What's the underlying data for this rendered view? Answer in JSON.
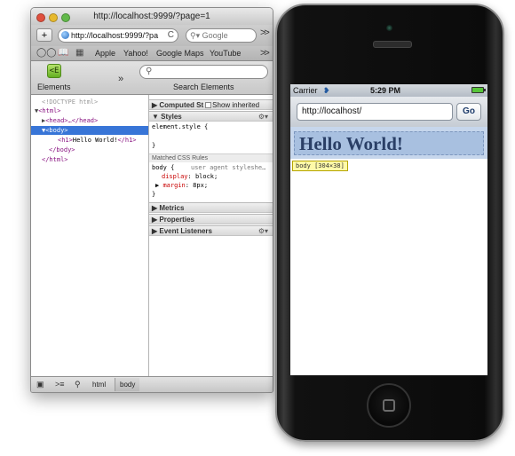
{
  "safari": {
    "title": "http://localhost:9999/?page=1",
    "url": "http://localhost:9999/?pa",
    "reload_glyph": "C",
    "search_placeholder": "Google",
    "bookmarks": [
      "Apple",
      "Yahoo!",
      "Google Maps",
      "YouTube"
    ],
    "chevron": ">>"
  },
  "inspector": {
    "elements_label": "Elements",
    "elements_glyph": "<E",
    "chevron": "»",
    "search_label": "Search Elements",
    "dom": {
      "doctype": "<!DOCTYPE html>",
      "html_open": "<html>",
      "head": "<head>…</head>",
      "body_open": "<body>",
      "h1_open": "<h1>",
      "h1_text": "Hello World!",
      "h1_close": "</h1>",
      "body_close": "</body>",
      "html_close": "</html>"
    },
    "sections": {
      "computed": "Computed St",
      "show_inherited": "Show inherited",
      "styles": "Styles",
      "element_style": "element.style {",
      "close_brace": "}",
      "matched_rules": "Matched CSS Rules",
      "body_selector": "body {",
      "ua_source": "user agent styleshe…",
      "display_prop": "display",
      "display_val": "block;",
      "margin_prop": "margin",
      "margin_val": "8px;",
      "metrics": "Metrics",
      "properties": "Properties",
      "event_listeners": "Event Listeners"
    },
    "breadcrumbs": [
      "html",
      "body"
    ]
  },
  "iphone": {
    "carrier": "Carrier",
    "time": "5:29 PM",
    "url": "http://localhost/",
    "go_label": "Go",
    "heading": "Hello World!",
    "tooltip": "body [304×38]"
  }
}
